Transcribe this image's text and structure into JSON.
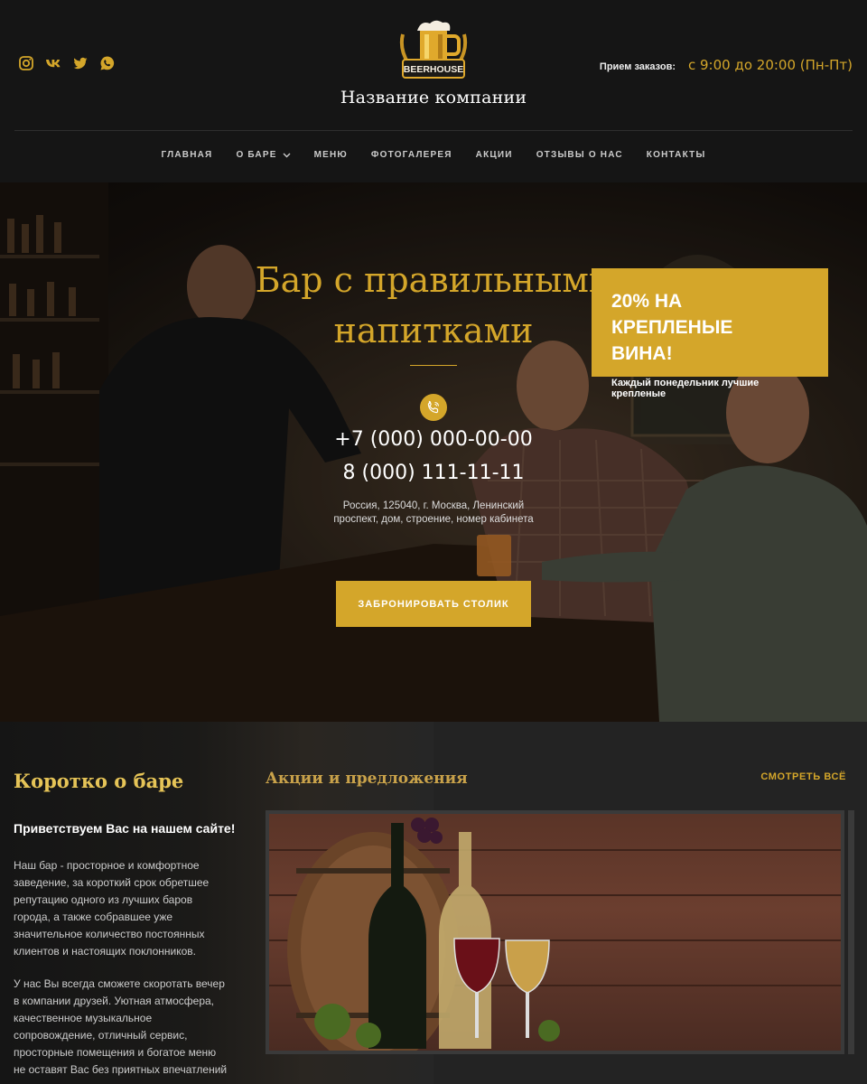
{
  "header": {
    "company_name": "Название компании",
    "logo_text": "BEERHOUSE",
    "hours_label": "Прием заказов:",
    "hours_value": "с 9:00 до 20:00 (Пн-Пт)",
    "socials": [
      "instagram-icon",
      "vk-icon",
      "twitter-icon",
      "whatsapp-icon"
    ]
  },
  "nav": {
    "items": [
      {
        "label": "ГЛАВНАЯ"
      },
      {
        "label": "О БАРЕ"
      },
      {
        "label": "МЕНЮ"
      },
      {
        "label": "ФОТОГАЛЕРЕЯ"
      },
      {
        "label": "АКЦИИ"
      },
      {
        "label": "ОТЗЫВЫ О НАС"
      },
      {
        "label": "КОНТАКТЫ"
      }
    ]
  },
  "hero": {
    "title_line1": "Бар с правильными",
    "title_line2": "напитками",
    "phone1": "+7 (000) 000-00-00",
    "phone2": "8 (000) 111-11-11",
    "address_line1": "Россия, 125040, г. Москва, Ленинский",
    "address_line2": "проспект, дом, строение, номер кабинета",
    "button_label": "ЗАБРОНИРОВАТЬ СТОЛИК"
  },
  "about": {
    "title": "Коротко о баре",
    "greeting": "Приветствуем Вас на нашем сайте!",
    "paragraph1": "Наш бар - просторное и комфортное заведение, за короткий срок обретшее репутацию одного из лучших баров города, а также собравшее уже значительное количество постоянных клиентов и настоящих поклонников.",
    "paragraph2": "У нас Вы всегда сможете скоротать вечер в компании друзей. Уютная атмосфера, качественное музыкальное сопровождение, отличный сервис, просторные помещения и богатое меню не оставят Вас без приятных впечатлений"
  },
  "promos": {
    "title": "Акции и предложения",
    "see_all": "СМОТРЕТЬ ВСЁ",
    "card_title_line1": "20% НА КРЕПЛЕНЫЕ",
    "card_title_line2": "ВИНА!",
    "card_text": "Каждый понедельник лучшие крепленые"
  },
  "colors": {
    "accent": "#d4a62a",
    "background": "#151515",
    "section": "#232323"
  }
}
